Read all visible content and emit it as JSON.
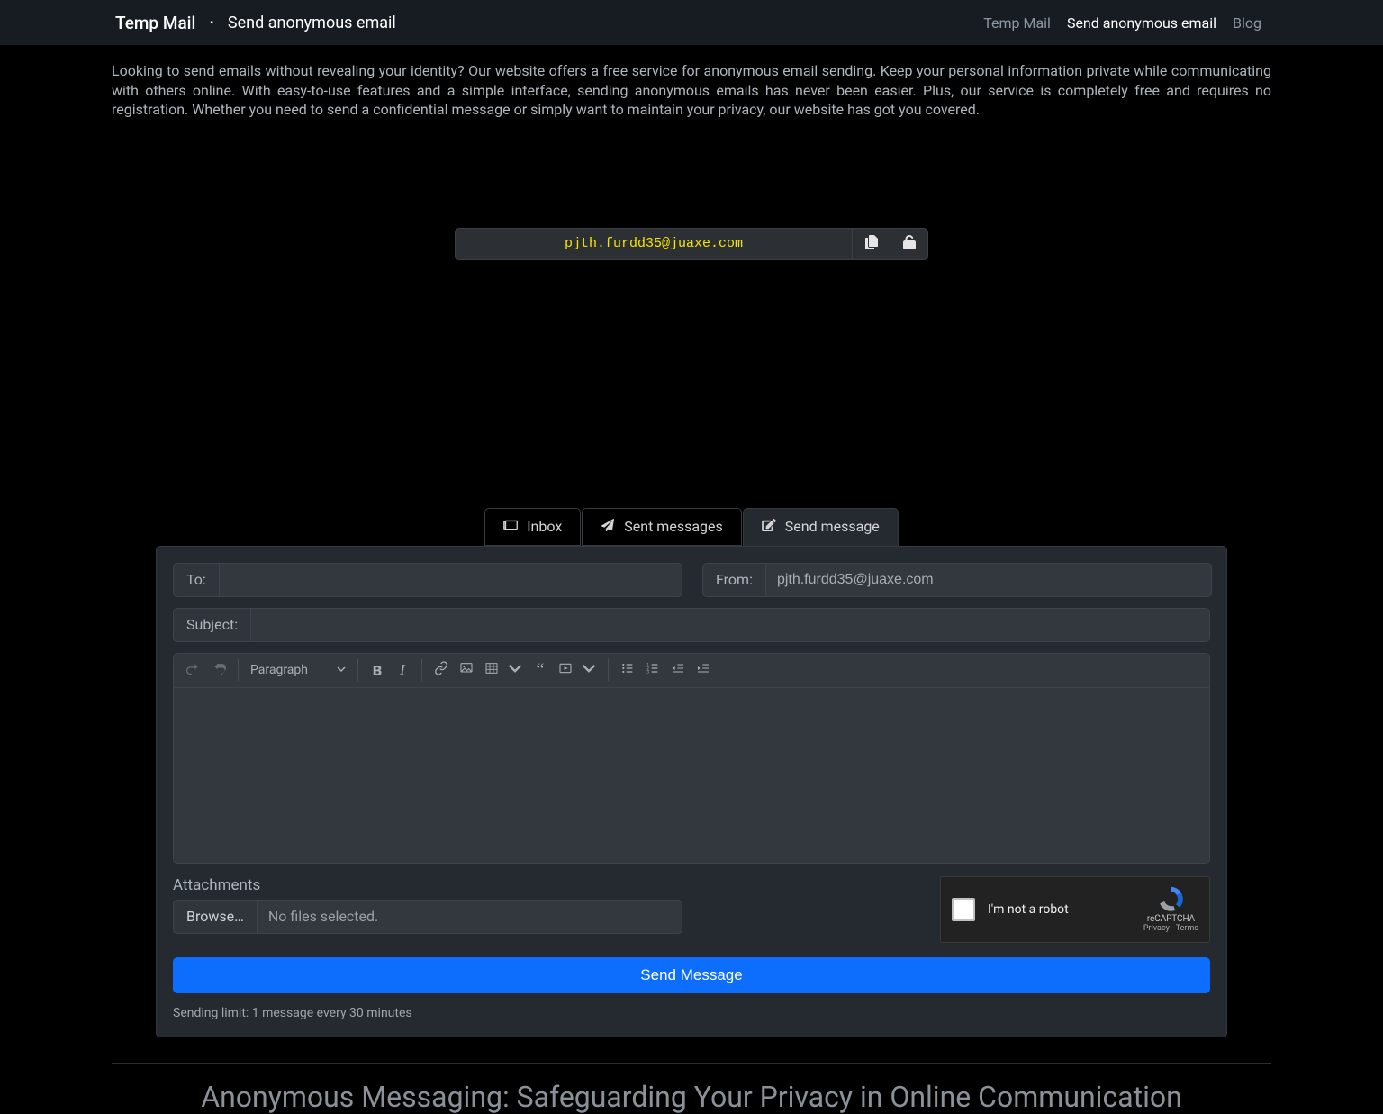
{
  "header": {
    "brand": "Temp Mail",
    "separator": "▪",
    "page_title": "Send anonymous email",
    "nav": [
      {
        "label": "Temp Mail",
        "active": false
      },
      {
        "label": "Send anonymous email",
        "active": true
      },
      {
        "label": "Blog",
        "active": false
      }
    ]
  },
  "intro": "Looking to send emails without revealing your identity? Our website offers a free service for anonymous email sending. Keep your personal information private while communicating with others online. With easy-to-use features and a simple interface, sending anonymous emails has never been easier. Plus, our service is completely free and requires no registration. Whether you need to send a confidential message or simply want to maintain your privacy, our website has got you covered.",
  "generated_email": "pjth.furdd35@juaxe.com",
  "tabs": [
    {
      "id": "inbox",
      "label": "Inbox",
      "active": false
    },
    {
      "id": "sent",
      "label": "Sent messages",
      "active": false
    },
    {
      "id": "compose",
      "label": "Send message",
      "active": true
    }
  ],
  "compose": {
    "to_label": "To:",
    "to_value": "",
    "from_label": "From:",
    "from_value": "pjth.furdd35@juaxe.com",
    "subject_label": "Subject:",
    "subject_value": "",
    "paragraph_selector": "Paragraph",
    "attachments_label": "Attachments",
    "browse_label": "Browse…",
    "file_status": "No files selected.",
    "send_button": "Send Message",
    "sending_limit": "Sending limit: 1 message every 30 minutes"
  },
  "recaptcha": {
    "label": "I'm not a robot",
    "brand": "reCAPTCHA",
    "terms": "Privacy - Terms"
  },
  "article_title": "Anonymous Messaging: Safeguarding Your Privacy in Online Communication"
}
